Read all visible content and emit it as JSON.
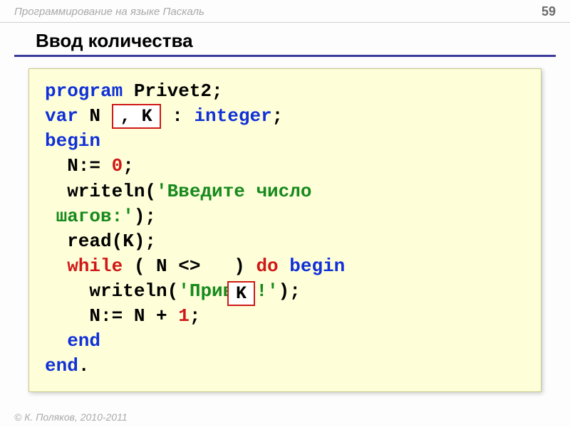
{
  "header": {
    "course_title": "Программирование на языке Паскаль",
    "page_number": "59"
  },
  "slide": {
    "title": "Ввод количества"
  },
  "code": {
    "l1_program": "program",
    "l1_name": " Privet2;",
    "l2_var": "var",
    "l2_n": " N ",
    "l2_comma_k": ", K",
    "l2_colon": " : ",
    "l2_integer": "integer",
    "l2_semi": ";",
    "l3_begin": "begin",
    "l4": "  N:= ",
    "l4_zero": "0",
    "l4_semi": ";",
    "l5a": "  writeln(",
    "l5b": "'Введите число",
    "l6a": " шагов:'",
    "l6b": ");",
    "l7": "  read(K);",
    "l7_k": "K",
    "l8a_while": "  while",
    "l8a_cond": " ( N <>   ) ",
    "l8_do": "do",
    "l8_begin": " begin",
    "l9a": "    writeln(",
    "l9b": "'Привет!'",
    "l9c": ");",
    "l10a": "    N:= N + ",
    "l10_one": "1",
    "l10b": ";",
    "l11": "  end",
    "l12a": "end",
    "l12b": "."
  },
  "footer": {
    "copyright": "© К. Поляков, 2010-2011"
  }
}
